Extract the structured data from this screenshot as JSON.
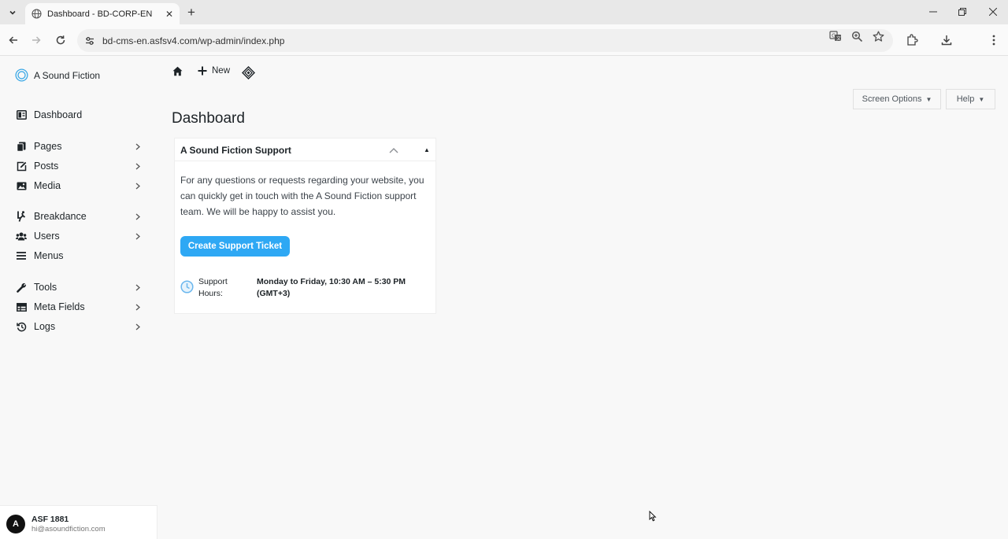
{
  "browser": {
    "tab_title": "Dashboard - BD-CORP-EN",
    "url": "bd-cms-en.asfsv4.com/wp-admin/index.php"
  },
  "brand": {
    "name": "A Sound Fiction"
  },
  "adminbar": {
    "new_label": "New"
  },
  "sidebar": {
    "items": [
      {
        "label": "Dashboard",
        "icon": "dashboard-icon"
      },
      {
        "label": "Pages",
        "icon": "pages-icon"
      },
      {
        "label": "Posts",
        "icon": "posts-icon"
      },
      {
        "label": "Media",
        "icon": "media-icon"
      },
      {
        "label": "Breakdance",
        "icon": "breakdance-icon"
      },
      {
        "label": "Users",
        "icon": "users-icon"
      },
      {
        "label": "Menus",
        "icon": "menus-icon"
      },
      {
        "label": "Tools",
        "icon": "tools-icon"
      },
      {
        "label": "Meta Fields",
        "icon": "table-icon"
      },
      {
        "label": "Logs",
        "icon": "history-icon"
      }
    ]
  },
  "header": {
    "screen_options": "Screen Options",
    "help": "Help"
  },
  "page": {
    "title": "Dashboard"
  },
  "widget": {
    "title": "A Sound Fiction Support",
    "text": "For any questions or requests regarding your website, you can quickly get in touch with the A Sound Fiction support team. We will be happy to assist you.",
    "cta": "Create Support Ticket",
    "hours_label": "Support Hours:",
    "hours_value": "Monday to Friday, 10:30 AM – 5:30 PM (GMT+3)"
  },
  "user": {
    "initial": "A",
    "name": "ASF 1881",
    "email": "hi@asoundfiction.com"
  },
  "colors": {
    "accent": "#2ea8f4",
    "background": "#f8f8f8"
  }
}
